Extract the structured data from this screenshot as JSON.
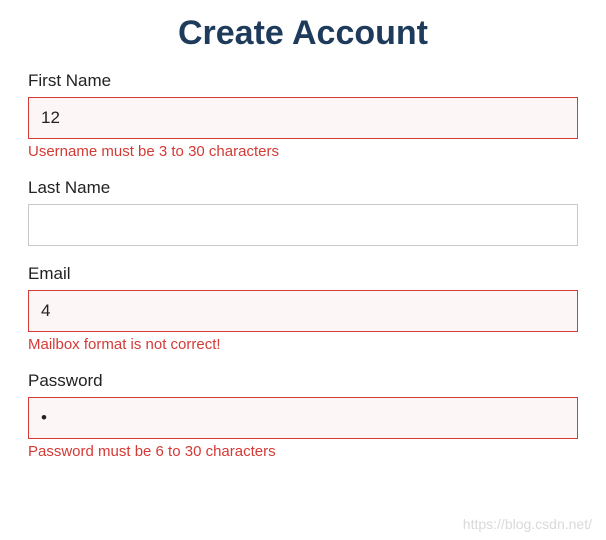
{
  "title": "Create Account",
  "fields": {
    "firstName": {
      "label": "First Name",
      "value": "12",
      "error": "Username must be 3 to 30 characters",
      "hasError": true
    },
    "lastName": {
      "label": "Last Name",
      "value": "",
      "error": "",
      "hasError": false
    },
    "email": {
      "label": "Email",
      "value": "4",
      "error": "Mailbox format is not correct!",
      "hasError": true
    },
    "password": {
      "label": "Password",
      "value": "•",
      "error": "Password must be 6 to 30 characters",
      "hasError": true
    }
  },
  "watermark": "https://blog.csdn.net/"
}
